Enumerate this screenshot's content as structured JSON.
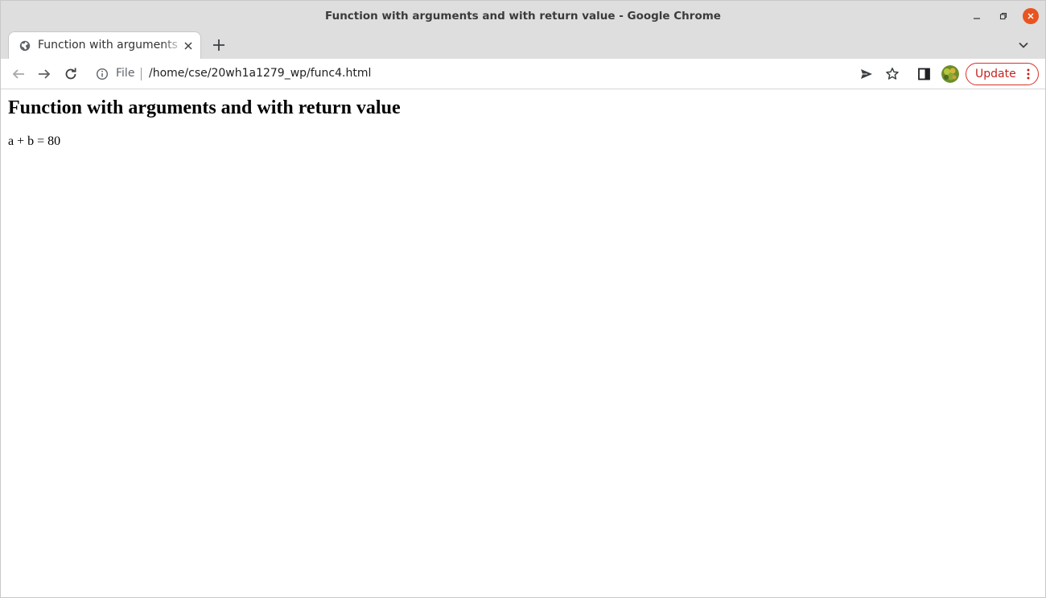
{
  "window": {
    "title": "Function with arguments and with return value - Google Chrome"
  },
  "tabs": [
    {
      "title": "Function with arguments and with return value",
      "active": true
    }
  ],
  "toolbar": {
    "scheme_label": "File",
    "url": "/home/cse/20wh1a1279_wp/func4.html",
    "update_label": "Update",
    "update_color": "#c5221f"
  },
  "icons": {
    "back": "arrow-left-icon",
    "forward": "arrow-right-icon",
    "reload": "reload-icon",
    "info": "info-icon",
    "send": "send-icon",
    "bookmark": "star-icon",
    "side_panel": "side-panel-icon",
    "menu": "vertical-dots-icon"
  },
  "page": {
    "heading": "Function with arguments and with return value",
    "result": "a + b = 80"
  }
}
